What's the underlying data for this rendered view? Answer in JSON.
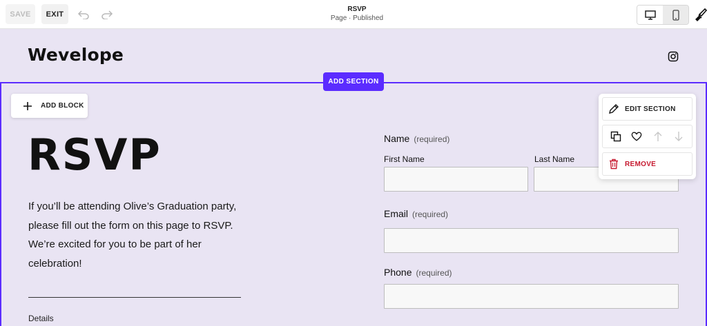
{
  "toolbar": {
    "save_label": "SAVE",
    "exit_label": "EXIT",
    "page_title": "RSVP",
    "page_status": "Page · Published"
  },
  "site": {
    "logo": "Wevelope"
  },
  "section": {
    "add_section_label": "ADD SECTION",
    "add_block_label": "ADD BLOCK",
    "title": "RSVP",
    "intro_lines": [
      "If you’ll be attending Olive’s Graduation party,",
      "please fill out the form on this page to RSVP.",
      "We’re excited for you to be part of her",
      "celebration!"
    ],
    "details_label": "Details"
  },
  "form": {
    "name_label": "Name",
    "name_required": "(required)",
    "first_name_label": "First Name",
    "last_name_label": "Last Name",
    "email_label": "Email",
    "email_required": "(required)",
    "phone_label": "Phone",
    "phone_required": "(required)"
  },
  "edit_menu": {
    "edit_section_label": "EDIT SECTION",
    "remove_label": "REMOVE"
  },
  "colors": {
    "accent": "#5b2cff",
    "background": "#e9e4f3",
    "remove": "#c6192f"
  }
}
